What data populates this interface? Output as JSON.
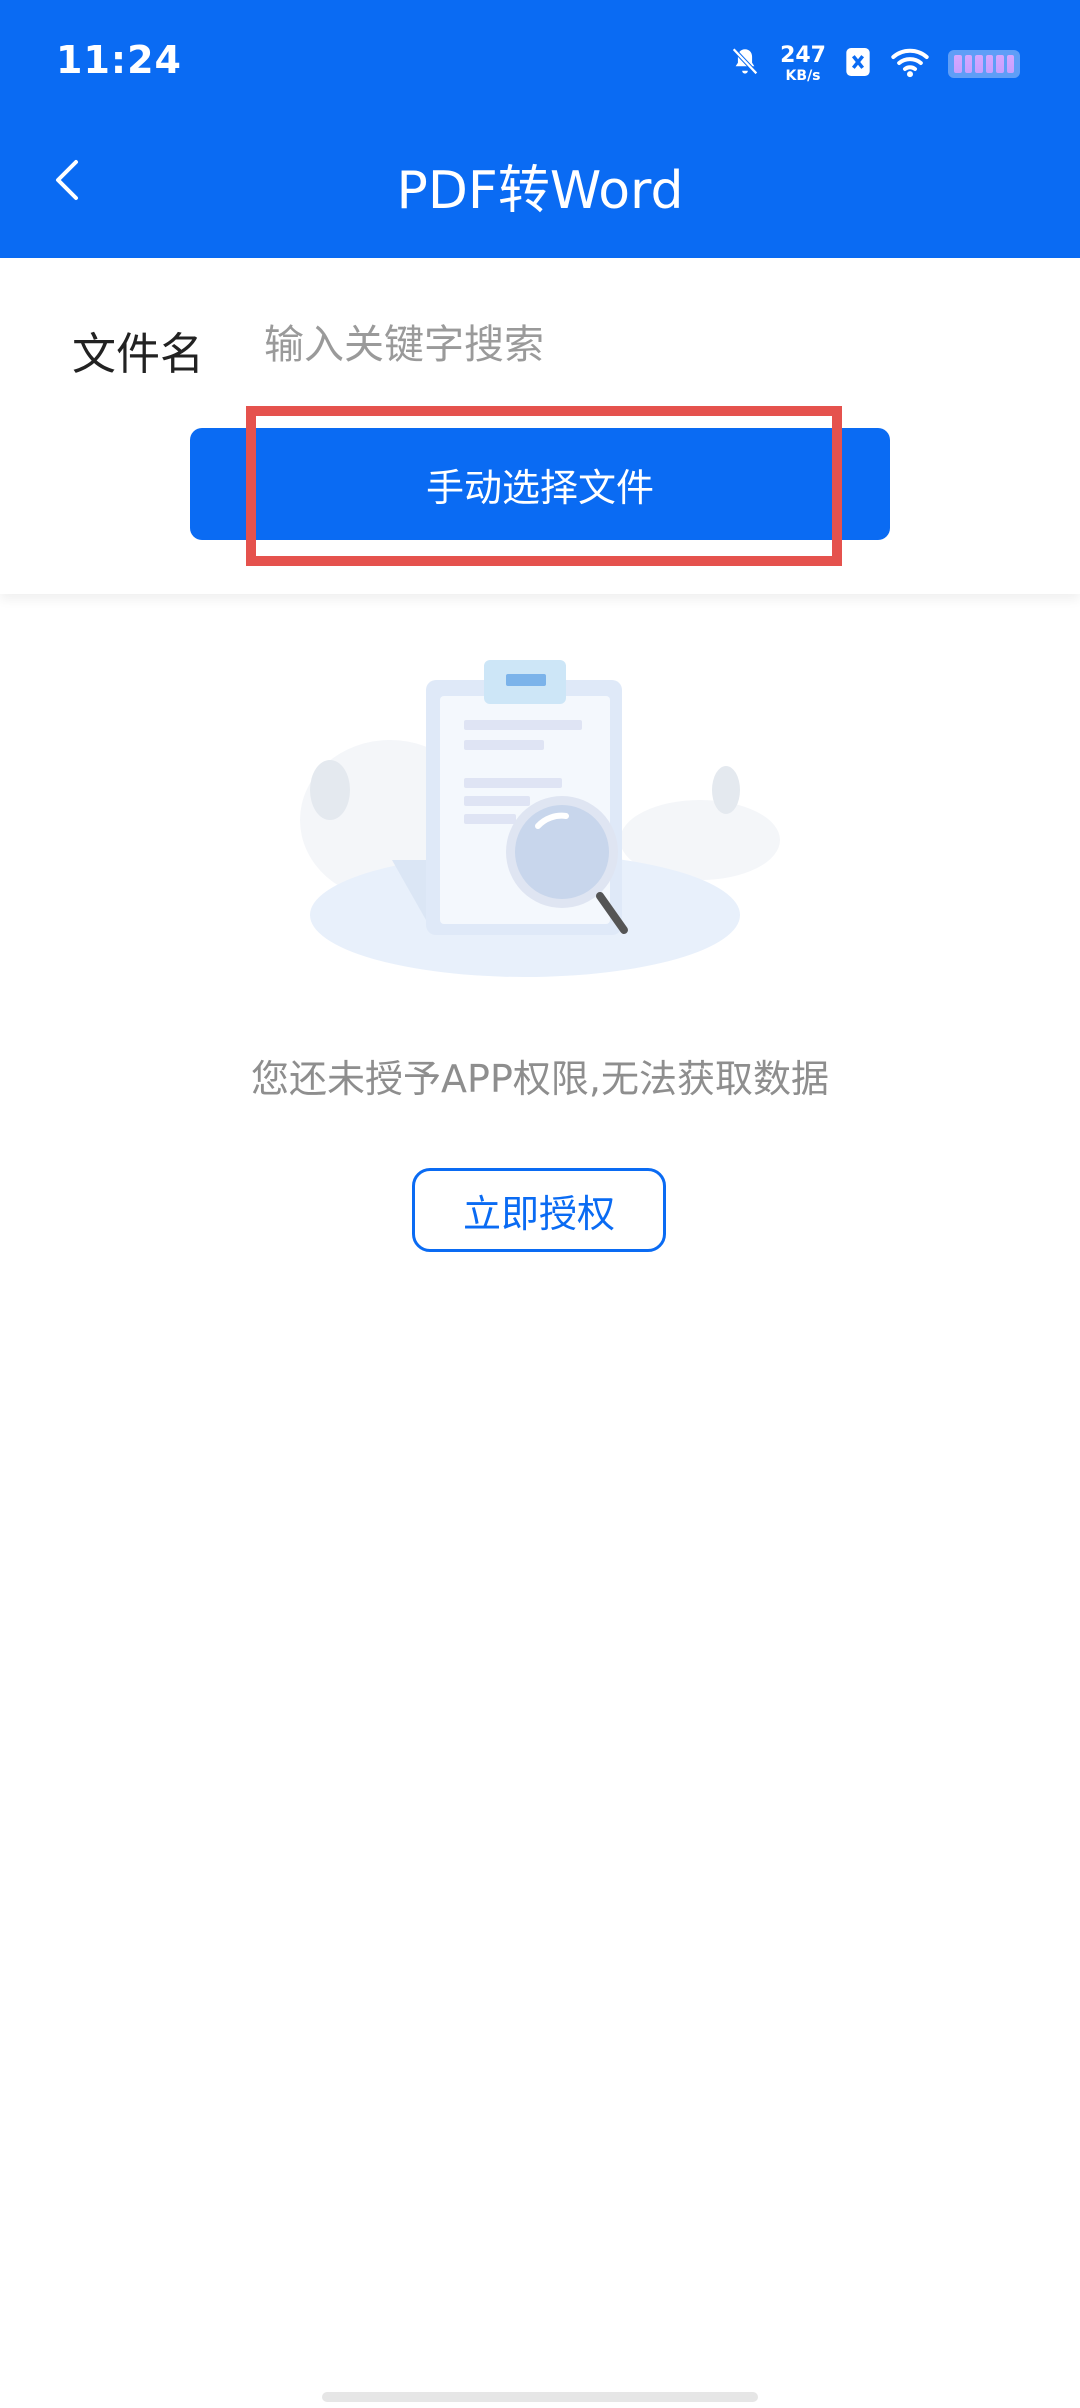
{
  "status_bar": {
    "time": "11:24",
    "network_speed_value": "247",
    "network_speed_unit": "KB/s",
    "icons": [
      "bell-muted-icon",
      "nfc-icon",
      "wifi-icon",
      "battery-icon"
    ]
  },
  "header": {
    "title": "PDF转Word",
    "back_icon": "chevron-left-icon"
  },
  "search": {
    "label": "文件名",
    "placeholder": "输入关键字搜索"
  },
  "actions": {
    "manual_select_label": "手动选择文件"
  },
  "empty_state": {
    "message": "您还未授予APP权限,无法获取数据",
    "authorize_label": "立即授权",
    "illustration": "document-search-illustration"
  },
  "colors": {
    "primary": "#0A6BF3",
    "highlight": "#E5524D"
  }
}
